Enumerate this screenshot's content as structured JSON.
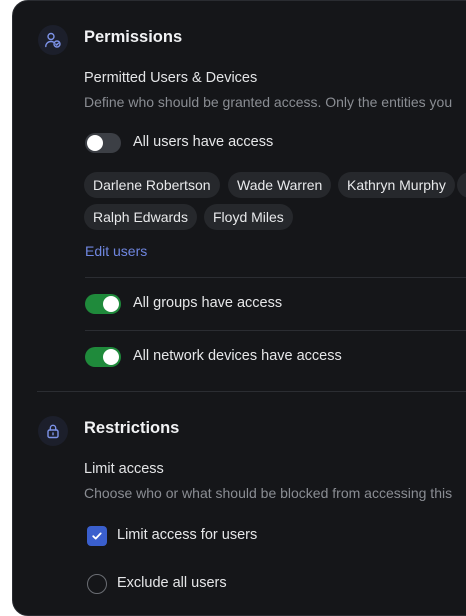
{
  "permissions": {
    "title": "Permissions",
    "icon": "user-check-icon",
    "subtitle": "Permitted Users & Devices",
    "description": "Define who should be granted access. Only the entities you",
    "all_users": {
      "label": "All users have access",
      "enabled": false
    },
    "users": [
      "Darlene Robertson",
      "Wade Warren",
      "Kathryn Murphy",
      "",
      "Ralph Edwards",
      "Floyd Miles"
    ],
    "edit_users_label": "Edit users",
    "all_groups": {
      "label": "All groups have access",
      "enabled": true
    },
    "all_devices": {
      "label": "All network devices have access",
      "enabled": true
    }
  },
  "restrictions": {
    "title": "Restrictions",
    "icon": "lock-icon",
    "subtitle": "Limit access",
    "description": "Choose who or what should be blocked from accessing this",
    "limit_users": {
      "label": "Limit access for users",
      "checked": true
    },
    "exclude_users": {
      "label": "Exclude all users",
      "checked": false
    }
  },
  "colors": {
    "panel_bg": "#151619",
    "accent_blue": "#3a5fcd",
    "toggle_on": "#1f8a3b",
    "link": "#6f86e0"
  }
}
